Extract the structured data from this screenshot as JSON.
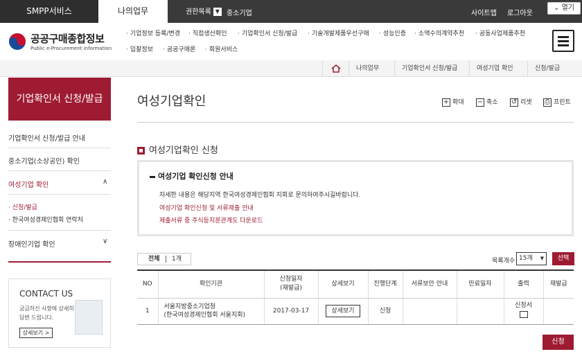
{
  "topbar": {
    "tab_smpp": "SMPP서비스",
    "tab_my": "나의업무",
    "role_label": "권한목록",
    "role_toggle": "▼",
    "role_value": "중소기업",
    "sitemap": "사이트맵",
    "logout": "로그아웃",
    "open": "⌄ 열기"
  },
  "header": {
    "logo_ko": "공공구매종합정보",
    "logo_en": "Public e-Procurement information",
    "gnb": [
      "기업정보 등록/변경",
      "직접생산확인",
      "기업확인서 신청/발급",
      "기술개발제품우선구매",
      "성능인증",
      "소액수의계약추천",
      "공동사업제품추천",
      "입찰정보",
      "공공구매론",
      "회원서비스"
    ]
  },
  "breadcrumb": [
    "나의업무",
    "기업확인서 신청/발급",
    "여성기업 확인",
    "신청/발급"
  ],
  "sidebar": {
    "title": "기업확인서 신청/발급",
    "items": [
      "기업확인서 신청/발급 안내",
      "중소기업(소상공인) 확인",
      "여성기업 확인",
      "장애인기업 확인"
    ],
    "subitems": [
      "신청/발급",
      "한국여성경제인협회 연락처"
    ],
    "expanded_chevron": "∧",
    "collapsed_chevron": "∨",
    "contact_title": "CONTACT US",
    "contact_desc": "궁금하신 사항에 상세히 답변 드립니다.",
    "contact_btn": "상세보기 >"
  },
  "main": {
    "title": "여성기업확인",
    "tools": [
      "확대",
      "축소",
      "리셋",
      "프린트"
    ],
    "section_title": "여성기업확인 신청",
    "guide": {
      "head": "여성기업 확인신청 안내",
      "text": "자세한 내용은 해당지역 한국여성경제인협회 지회로 문의하여주시길바랍니다.",
      "link1": "여성기업 확인신청 및 서류제출 안내",
      "link2": "제출서류 중 주식등지분관계도 다운로드"
    },
    "count_label": "전체",
    "count_value": "1개",
    "per_page_label": "목록개수",
    "per_page_value": "15개",
    "select_btn": "선택",
    "apply_btn": "신청"
  },
  "table": {
    "headers": [
      "NO",
      "확인기관",
      "신청일자\n(재발급)",
      "상세보기",
      "진행단계",
      "서류보안 안내",
      "만료일자",
      "출력",
      "재발급"
    ],
    "rows": [
      {
        "no": "1",
        "org1": "서울지방중소기업청",
        "org2": "(한국여성경제인협회 서울지회)",
        "date": "2017-03-17",
        "detail": "상세보기",
        "stage": "신청",
        "docs": "",
        "expire": "",
        "print": "신청서",
        "reissue": ""
      }
    ]
  },
  "colors": {
    "accent": "#9e1b32",
    "topbar": "#3a3a3a"
  }
}
